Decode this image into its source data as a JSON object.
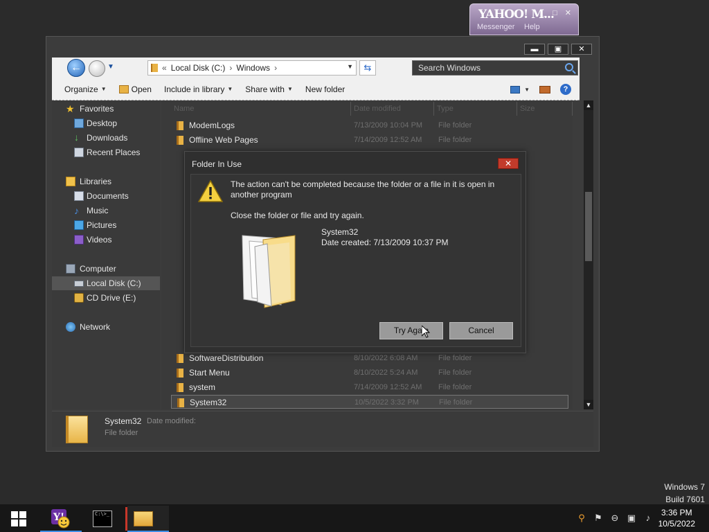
{
  "yahoo_widget": {
    "logo": "YAHOO! M...",
    "messenger": "Messenger",
    "help": "Help",
    "controls": "_ □ ✕"
  },
  "window": {
    "minimize": "▬",
    "maximize": "▣",
    "close": "✕"
  },
  "navbar": {
    "path_prefix": "«",
    "path": [
      "Local Disk (C:)",
      "Windows"
    ],
    "search_placeholder": "Search Windows"
  },
  "toolbar": {
    "organize": "Organize",
    "open": "Open",
    "include_in_library": "Include in library",
    "share_with": "Share with",
    "new_folder": "New folder"
  },
  "sidebar": {
    "favorites": "Favorites",
    "desktop": "Desktop",
    "downloads": "Downloads",
    "recent_places": "Recent Places",
    "libraries": "Libraries",
    "documents": "Documents",
    "music": "Music",
    "pictures": "Pictures",
    "videos": "Videos",
    "computer": "Computer",
    "local_disk": "Local Disk (C:)",
    "cd_drive": "CD Drive (E:)",
    "network": "Network"
  },
  "columns": {
    "name": "Name",
    "date_modified": "Date modified",
    "type": "Type",
    "size": "Size"
  },
  "files": [
    {
      "name": "ModemLogs",
      "date": "7/13/2009 10:04 PM",
      "type": "File folder"
    },
    {
      "name": "Offline Web Pages",
      "date": "7/14/2009 12:52 AM",
      "type": "File folder"
    },
    {
      "name": "SoftwareDistribution",
      "date": "8/10/2022 6:08 AM",
      "type": "File folder"
    },
    {
      "name": "Start Menu",
      "date": "8/10/2022 5:24 AM",
      "type": "File folder"
    },
    {
      "name": "system",
      "date": "7/14/2009 12:52 AM",
      "type": "File folder"
    },
    {
      "name": "System32",
      "date": "10/5/2022 3:32 PM",
      "type": "File folder"
    }
  ],
  "details": {
    "name": "System32",
    "date_label": "Date modified:",
    "type": "File folder"
  },
  "dialog": {
    "title": "Folder In Use",
    "close": "✕",
    "message": "The action can't be completed because the folder or a file in it is open in another program",
    "instruction": "Close the folder or file and try again.",
    "folder_name": "System32",
    "date_created": "Date created: 7/13/2009 10:37 PM",
    "try_again": "Try Again",
    "cancel": "Cancel"
  },
  "os": {
    "line1": "Windows 7",
    "line2": "Build 7601"
  },
  "clock": {
    "time": "3:36 PM",
    "date": "10/5/2022"
  },
  "cmd_text": "C:\\>_"
}
